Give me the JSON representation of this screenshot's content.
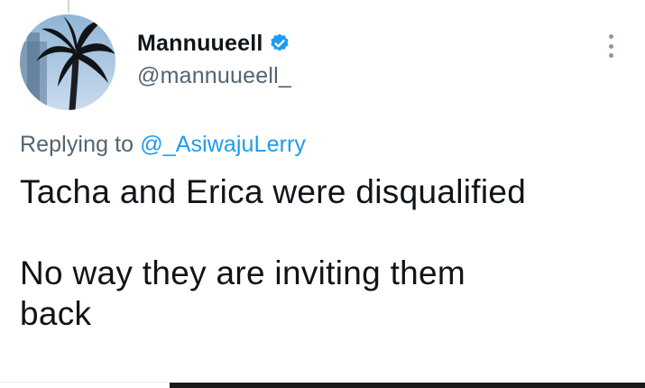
{
  "author": {
    "display_name": "Mannuueell",
    "handle": "@mannuueell_",
    "verified": true,
    "verified_icon": "verified-badge-icon",
    "avatar_icon": "palm-tree-photo"
  },
  "reply": {
    "prefix": "Replying to ",
    "mention": "@_AsiwajuLerry"
  },
  "tweet": {
    "line1": "Tacha and Erica were disqualified",
    "line2": "No way they are inviting them",
    "line3": "back"
  },
  "more_icon": "more-options-icon",
  "colors": {
    "accent": "#1d9bf0",
    "text": "#0f1419",
    "secondary": "#536471"
  }
}
